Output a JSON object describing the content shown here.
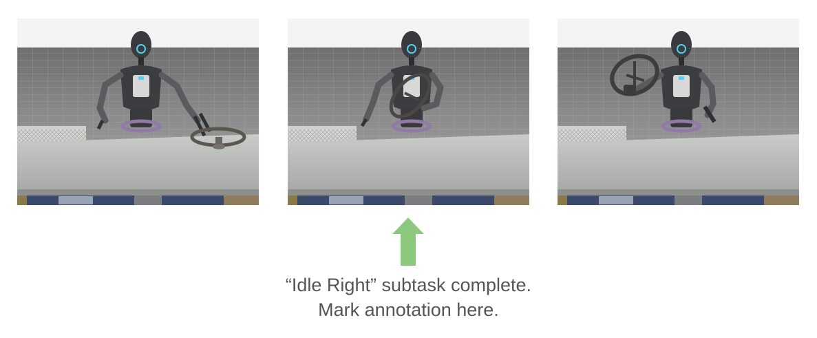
{
  "figure": {
    "panels": [
      {
        "icon": "robot-scene-grasp-wheel"
      },
      {
        "icon": "robot-scene-lift-wheel"
      },
      {
        "icon": "robot-scene-raise-wheel"
      }
    ],
    "arrow": {
      "icon": "up-arrow-icon",
      "color": "#8cc97e"
    },
    "caption_line1": "“Idle Right” subtask complete.",
    "caption_line2": "Mark annotation here."
  }
}
